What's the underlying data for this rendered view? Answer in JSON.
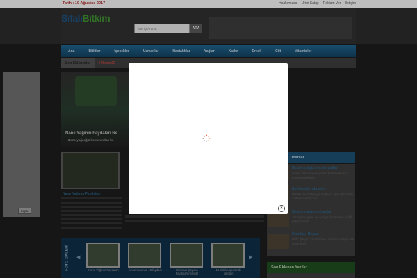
{
  "topbar": {
    "date": "Tarih : 19 Ağustos 2017",
    "links": [
      "Hakkımızda",
      "Ürün Satışı",
      "Reklam Ver",
      "İletişim"
    ]
  },
  "header": {
    "logo_part1": "Sifalı",
    "logo_part2": "Bitkim",
    "search_placeholder": "Site içi Arama",
    "search_button": "ARA"
  },
  "nav": {
    "items": [
      "Ana",
      "Bitkiler",
      "İçecekler",
      "Uzmanlar",
      "Hastalıklar",
      "Yağlar",
      "Kadın",
      "Erkek",
      "Cilt",
      "Vitaminler"
    ]
  },
  "subbar": {
    "tag": "Son Eklenenler",
    "latest": "4 Nisan 20"
  },
  "left_ad": {
    "close_label": "Kapat"
  },
  "feature": {
    "title": "Nane Yağının Faydaları Ne",
    "desc": "Nane yağı ağız kokusundan ko"
  },
  "article": {
    "title": "Nane Yağının Faydaları"
  },
  "popular": {
    "header": "unanlar",
    "items": [
      {
        "title": "Bebek düşürmenin yolları",
        "desc": "Çocuk düşürmenin yolları Hamilelikten 1 erken gebelikten"
      },
      {
        "title": "diz kapağında sıvı",
        "desc": "Dizdeki bir bağ veya bağların aşırı derecede zorlanmasıdır. Diz"
      },
      {
        "title": "Bebek düşüren ilaçlar",
        "desc": "Türkiye'de genç ve orta yaşlı nüfusun, ciddi yaşamındaki"
      },
      {
        "title": "Kandaki Beyaz",
        "desc": "WBC (beyaz kan hücresi) vücudun bağışıklık sisteminin"
      }
    ]
  },
  "recent": {
    "header": "Son Eklenen Yazılar"
  },
  "gallery": {
    "label": "FOTO GALERİ",
    "prev": "◀",
    "next": "▶",
    "items": [
      {
        "caption": "Nane Yağının Faydaları"
      },
      {
        "caption": "limon suyunun 10 faydası"
      },
      {
        "caption": "Hibiskus Çayının Faydaları nelerdir"
      },
      {
        "caption": "10 dakika içerisinde gripten"
      }
    ]
  },
  "modal": {
    "close_glyph": "×"
  }
}
